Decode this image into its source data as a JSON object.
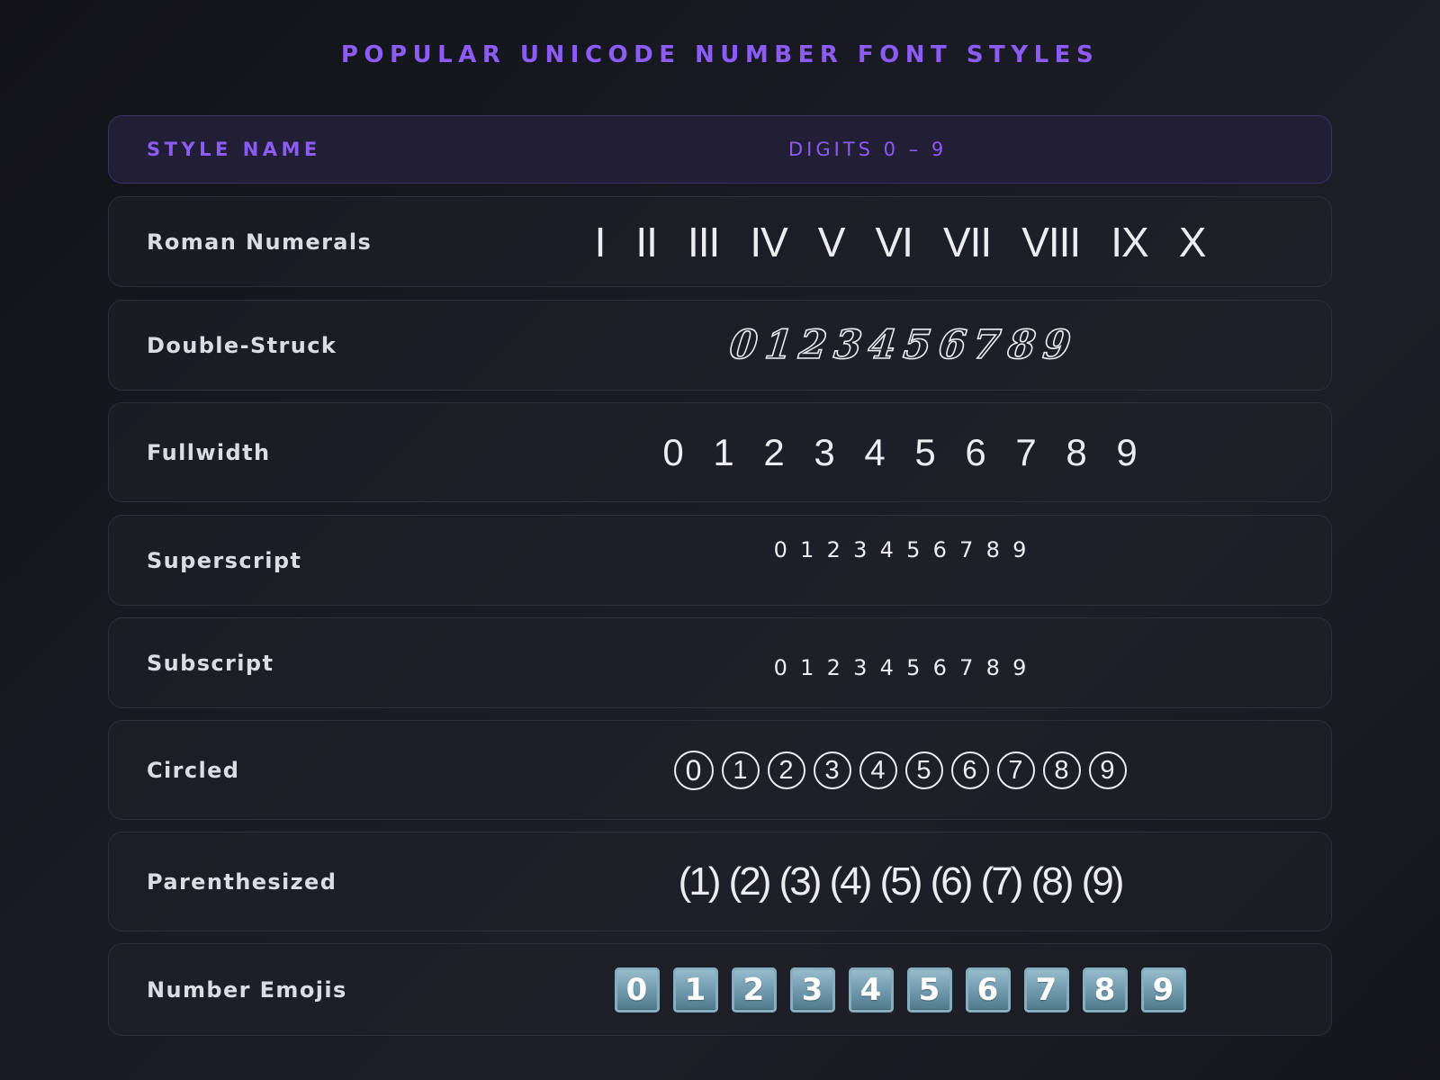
{
  "title": "POPULAR UNICODE NUMBER FONT STYLES",
  "header": {
    "style_name": "STYLE NAME",
    "digits": "DIGITS 0 – 9"
  },
  "rows": [
    {
      "name": "Roman Numerals",
      "glyphs": [
        "I",
        "II",
        "III",
        "IV",
        "V",
        "VI",
        "VII",
        "VIII",
        "IX",
        "X"
      ]
    },
    {
      "name": "Double-Struck",
      "glyphs": [
        "0",
        "1",
        "2",
        "3",
        "4",
        "5",
        "6",
        "7",
        "8",
        "9"
      ]
    },
    {
      "name": "Fullwidth",
      "glyphs": [
        "0",
        "1",
        "2",
        "3",
        "4",
        "5",
        "6",
        "7",
        "8",
        "9"
      ]
    },
    {
      "name": "Superscript",
      "glyphs": [
        "0",
        "1",
        "2",
        "3",
        "4",
        "5",
        "6",
        "7",
        "8",
        "9"
      ]
    },
    {
      "name": "Subscript",
      "glyphs": [
        "0",
        "1",
        "2",
        "3",
        "4",
        "5",
        "6",
        "7",
        "8",
        "9"
      ]
    },
    {
      "name": "Circled",
      "glyphs": [
        "0",
        "1",
        "2",
        "3",
        "4",
        "5",
        "6",
        "7",
        "8",
        "9"
      ]
    },
    {
      "name": "Parenthesized",
      "glyphs": [
        "(1)",
        "(2)",
        "(3)",
        "(4)",
        "(5)",
        "(6)",
        "(7)",
        "(8)",
        "(9)"
      ]
    },
    {
      "name": "Number Emojis",
      "glyphs": [
        "0",
        "1",
        "2",
        "3",
        "4",
        "5",
        "6",
        "7",
        "8",
        "9"
      ]
    }
  ],
  "colors": {
    "accent": "#8b5cf6",
    "text": "#ececf2",
    "emoji_key": "#6d97ab"
  }
}
